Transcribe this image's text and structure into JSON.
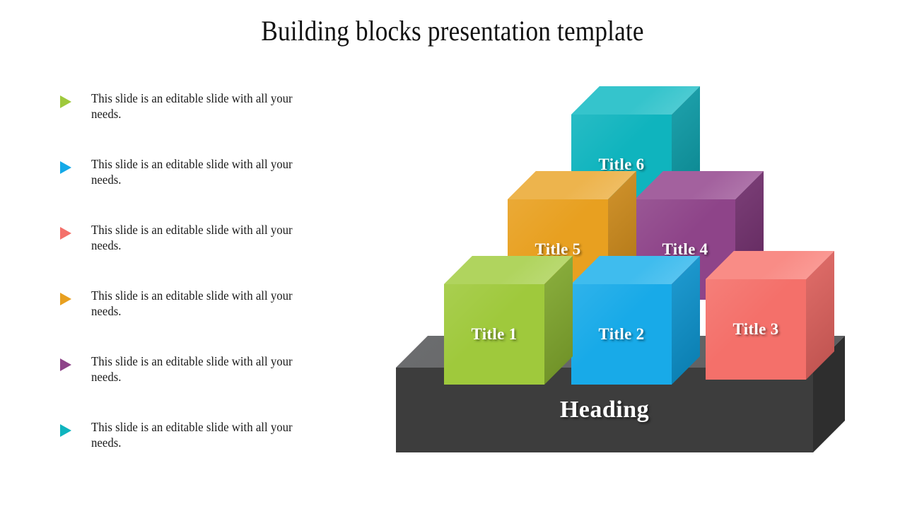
{
  "slide": {
    "title": "Building blocks presentation template",
    "background_color": "#FFFFFF"
  },
  "bullets": [
    {
      "text": "This slide is an editable slide with all your needs.",
      "marker_color": "#9FC93C",
      "marker_icon": "triangle-right-icon"
    },
    {
      "text": "This slide is an editable slide with all your needs.",
      "marker_color": "#14A9E8",
      "marker_icon": "triangle-right-icon"
    },
    {
      "text": "This slide is an editable slide with all your needs.",
      "marker_color": "#F4706A",
      "marker_icon": "triangle-right-icon"
    },
    {
      "text": "This slide is an editable slide with all your needs.",
      "marker_color": "#E8A020",
      "marker_icon": "triangle-right-icon"
    },
    {
      "text": "This slide is an editable slide with all your needs.",
      "marker_color": "#8E4489",
      "marker_icon": "triangle-right-icon"
    },
    {
      "text": "This slide is an editable slide with all your needs.",
      "marker_color": "#0FB4BE",
      "marker_icon": "triangle-right-icon"
    }
  ],
  "diagram": {
    "base": {
      "label": "Heading",
      "top_color": "#636466",
      "front_color": "#3D3D3D",
      "side_color": "#2E2E2E"
    },
    "blocks": [
      {
        "label": "Title 1",
        "front_color": "#9FC93C",
        "top_color": "#B0D45E",
        "side_color": "#7FA52E",
        "row": 1,
        "col": 1
      },
      {
        "label": "Title 2",
        "front_color": "#18AAE8",
        "top_color": "#3FBCEE",
        "side_color": "#0E90C9",
        "row": 1,
        "col": 2
      },
      {
        "label": "Title 3",
        "front_color": "#F4706A",
        "top_color": "#F98C86",
        "side_color": "#D9605C",
        "row": 1,
        "col": 3
      },
      {
        "label": "Title 5",
        "front_color": "#E8A020",
        "top_color": "#EDB44D",
        "side_color": "#C8871B",
        "row": 2,
        "col": 1
      },
      {
        "label": "Title 4",
        "front_color": "#8E4489",
        "top_color": "#A3619E",
        "side_color": "#6F2F6B",
        "row": 2,
        "col": 2
      },
      {
        "label": "Title 6",
        "front_color": "#0FB4BE",
        "top_color": "#35C4CC",
        "side_color": "#0D97A2",
        "row": 3,
        "col": 1
      }
    ]
  }
}
